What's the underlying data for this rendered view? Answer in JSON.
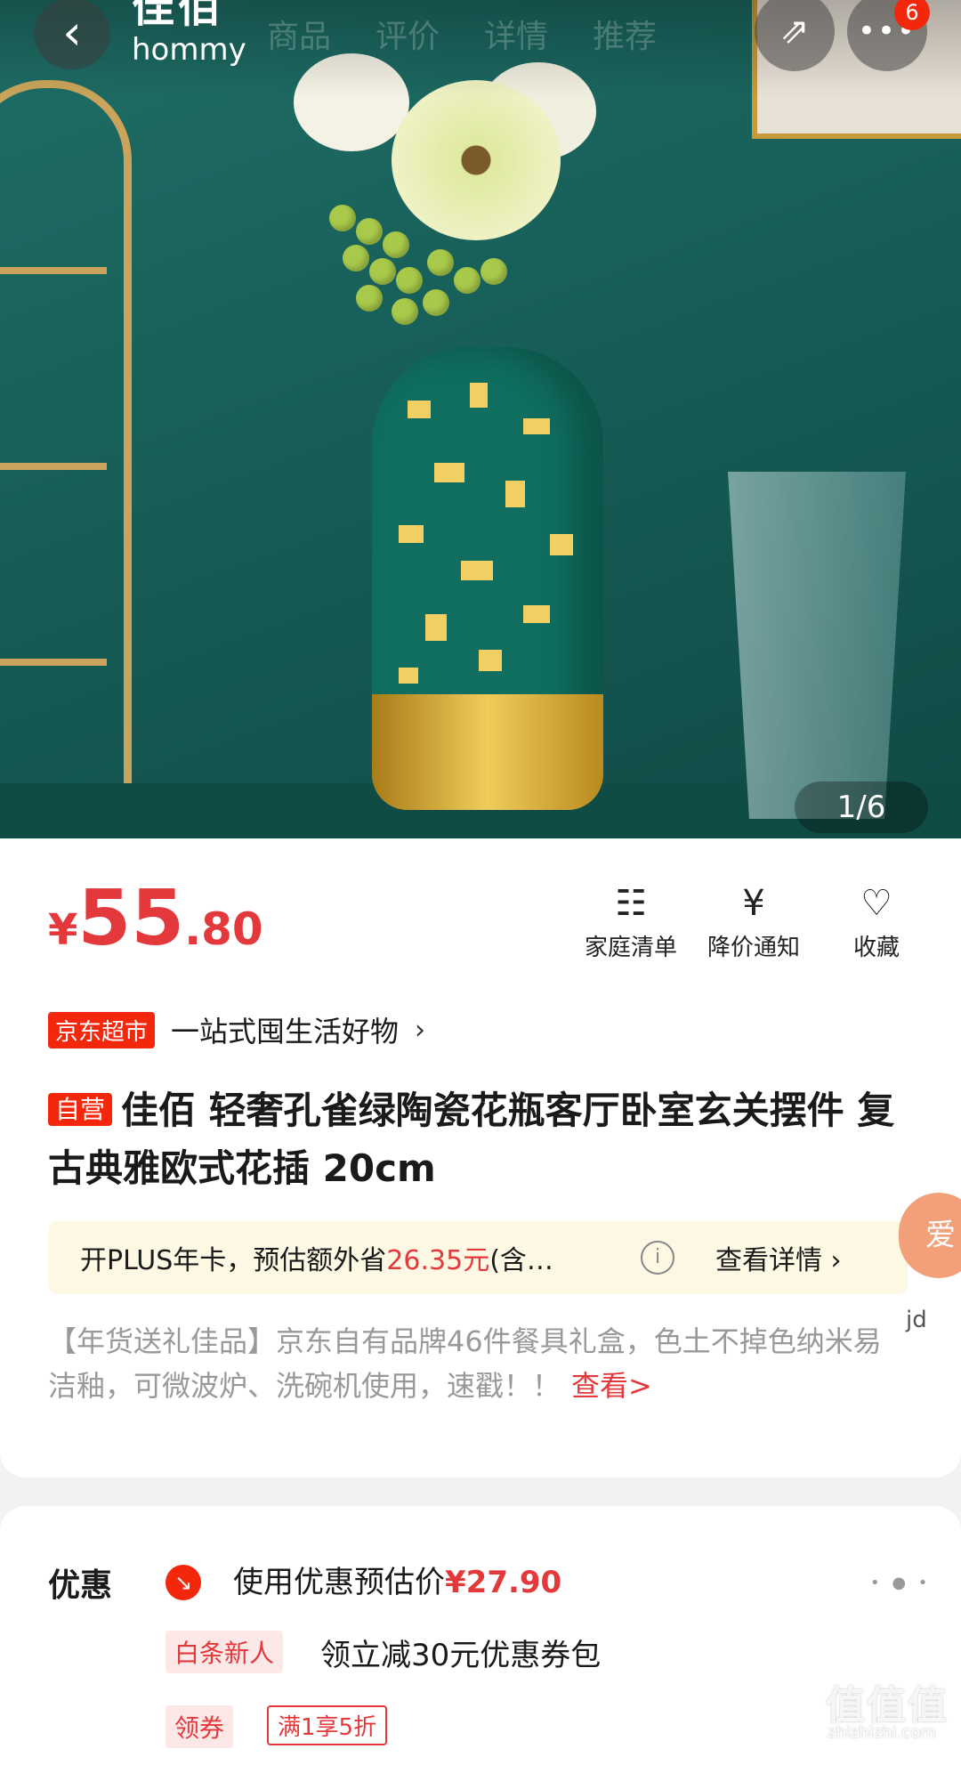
{
  "nav": {
    "brand_cn": "佳佰",
    "brand_en": "hommy",
    "tabs": [
      "商品",
      "评价",
      "详情",
      "推荐"
    ],
    "more_badge": "6"
  },
  "gallery": {
    "counter": "1/6"
  },
  "price": {
    "currency": "¥",
    "integer": "55",
    "decimal": ".80"
  },
  "actions": [
    {
      "label": "家庭清单",
      "icon": "list-add-icon"
    },
    {
      "label": "降价通知",
      "icon": "price-alert-icon"
    },
    {
      "label": "收藏",
      "icon": "heart-icon"
    }
  ],
  "store": {
    "tag": "京东超市",
    "slogan": "一站式囤生活好物"
  },
  "product": {
    "tag": "自营",
    "title": "佳佰 轻奢孔雀绿陶瓷花瓶客厅卧室玄关摆件 复古典雅欧式花插 20cm"
  },
  "plus": {
    "prefix": "开PLUS年卡，预估额外省",
    "amount": "26.35元",
    "suffix": "(含…",
    "detail": "查看详情 ›"
  },
  "promo": {
    "text": "【年货送礼佳品】京东自有品牌46件餐具礼盒，色土不掉色纳米易洁釉，可微波炉、洗碗机使用，速戳！！",
    "link": "查看>"
  },
  "floating": {
    "love": "爱",
    "jd": "jd"
  },
  "discount": {
    "label": "优惠",
    "estimate_prefix": "使用优惠预估价",
    "estimate_price": "¥27.90",
    "newbie_tag": "白条新人",
    "newbie_text": "领立减30元优惠券包",
    "coupon_tag": "领券",
    "coupon_text": "满1享5折"
  },
  "watermark": {
    "main": "值值值",
    "sub": "zhizhizhi.com"
  },
  "colors": {
    "accent": "#e4393c",
    "jd_red": "#f2270c",
    "plus_bg": "#fdf8e4",
    "hero_bg": "#175e58"
  }
}
